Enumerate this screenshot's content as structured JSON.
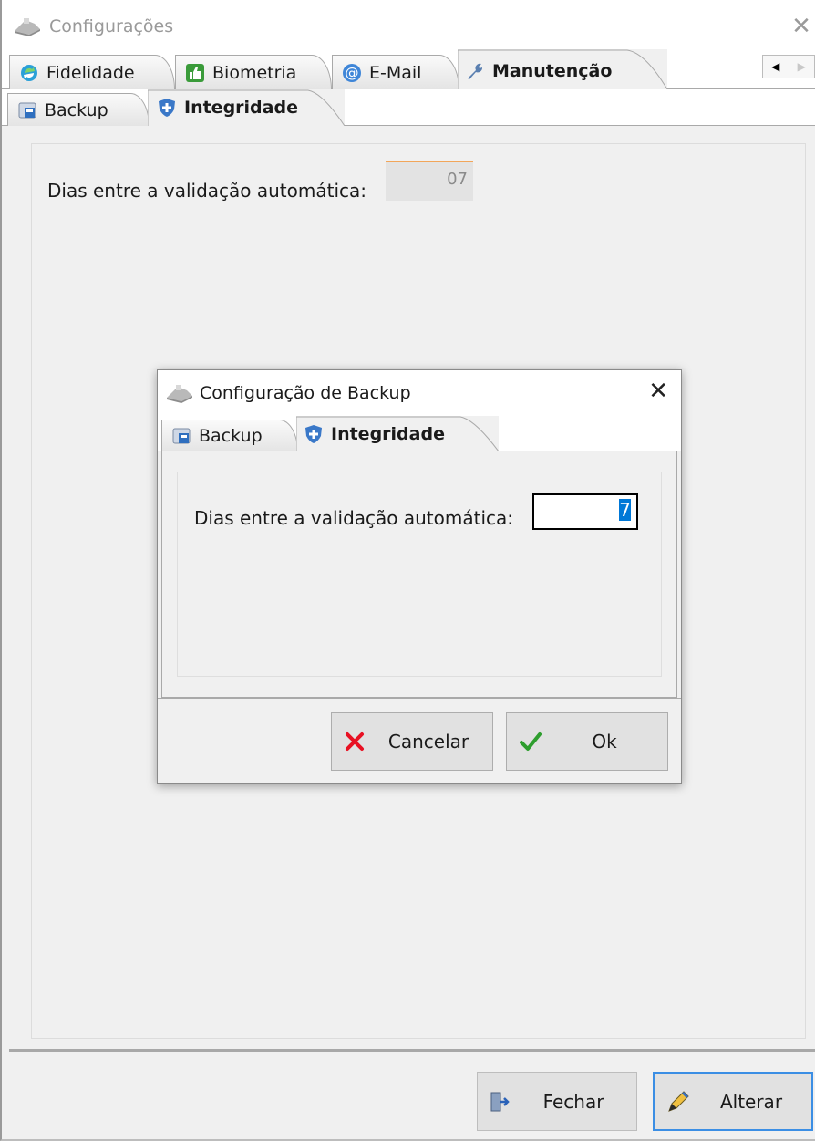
{
  "window": {
    "title": "Configurações"
  },
  "main_tabs": [
    {
      "label": "Fidelidade",
      "icon": "refresh-icon",
      "active": false
    },
    {
      "label": "Biometria",
      "icon": "thumbs-up-icon",
      "active": false
    },
    {
      "label": "E-Mail",
      "icon": "at-sign-icon",
      "active": false
    },
    {
      "label": "Manutenção",
      "icon": "wrench-icon",
      "active": true
    }
  ],
  "sub_tabs": [
    {
      "label": "Backup",
      "icon": "backup-icon",
      "active": false
    },
    {
      "label": "Integridade",
      "icon": "shield-icon",
      "active": true
    }
  ],
  "integrity": {
    "label": "Dias entre a validação automática:",
    "value": "07"
  },
  "dialog": {
    "title": "Configuração de Backup",
    "tabs": [
      {
        "label": "Backup",
        "icon": "backup-icon",
        "active": false
      },
      {
        "label": "Integridade",
        "icon": "shield-icon",
        "active": true
      }
    ],
    "field_label": "Dias entre a validação automática:",
    "field_value": "7",
    "cancel_label": "Cancelar",
    "ok_label": "Ok"
  },
  "footer": {
    "close_label": "Fechar",
    "edit_label": "Alterar"
  },
  "colors": {
    "accent": "#0078d7",
    "focus_border": "#3b8ee4",
    "cancel_red": "#e81123",
    "ok_green": "#2e9e2e"
  }
}
